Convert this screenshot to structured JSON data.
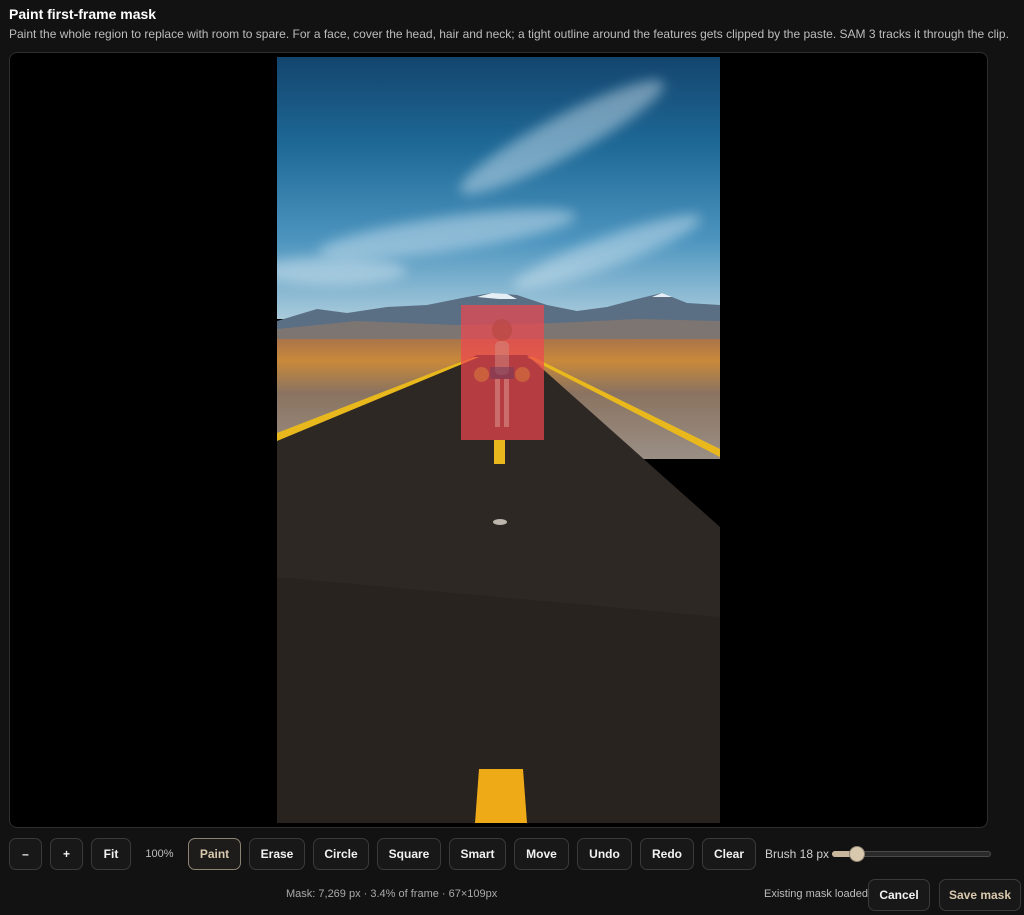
{
  "header": {
    "title": "Paint first-frame mask",
    "subtitle": "Paint the whole region to replace with room to spare. For a face, cover the head, hair and neck; a tight outline around the features gets clipped by the paste. SAM 3 tracks it through the clip."
  },
  "toolbar": {
    "zoom_out_label": "–",
    "zoom_in_label": "+",
    "fit_label": "Fit",
    "zoom_level": "100%",
    "tools": [
      {
        "label": "Paint",
        "active": true
      },
      {
        "label": "Erase",
        "active": false
      },
      {
        "label": "Circle",
        "active": false
      },
      {
        "label": "Square",
        "active": false
      },
      {
        "label": "Smart",
        "active": false
      },
      {
        "label": "Move",
        "active": false
      },
      {
        "label": "Undo",
        "active": false
      },
      {
        "label": "Redo",
        "active": false
      },
      {
        "label": "Clear",
        "active": false
      }
    ],
    "brush_label": "Brush 18 px",
    "brush_size_fraction": 0.12
  },
  "footer": {
    "mask_info": "Mask: 7,269 px · 3.4% of frame · 67×109px",
    "status": "Existing mask loaded",
    "cancel_label": "Cancel",
    "save_label": "Save mask"
  },
  "colors": {
    "mask_overlay": "#f04650",
    "active_accent": "#d8c8ae",
    "background": "#121212"
  }
}
